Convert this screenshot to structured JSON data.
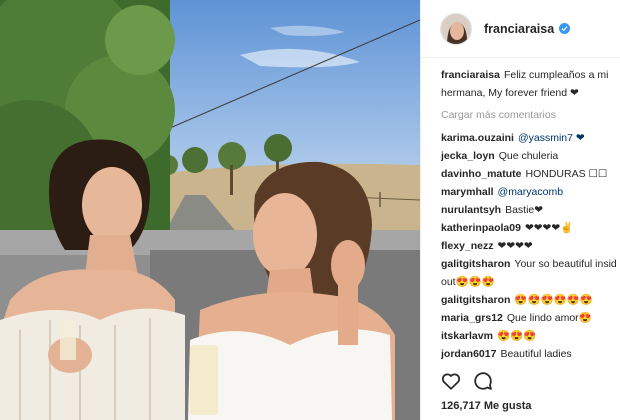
{
  "post": {
    "username": "franciaraisa",
    "caption": "Feliz cumpleaños a mi hermana, My forever friend ❤",
    "load_more": "Cargar más comentarios",
    "likes": "126,717 Me gusta"
  },
  "comments": [
    {
      "user": "karima.ouzaini",
      "text": "@yassmin7 ❤"
    },
    {
      "user": "jecka_loyn",
      "text": "Que chuleria"
    },
    {
      "user": "davinho_matute",
      "text": "HONDURAS ☐☐"
    },
    {
      "user": "marymhall",
      "text": "@maryacomb"
    },
    {
      "user": "nurulantsyh",
      "text": "Bastie❤"
    },
    {
      "user": "katherinpaola09",
      "text": "❤❤❤❤✌"
    },
    {
      "user": "flexy_nezz",
      "text": "❤❤❤❤"
    },
    {
      "user": "galitgitsharon",
      "text": "Your so beautiful insid out😍😍😍"
    },
    {
      "user": "galitgitsharon",
      "text": "😍😍😍😍😍😍"
    },
    {
      "user": "maria_grs12",
      "text": "Que lindo amor😍"
    },
    {
      "user": "itskarlavm",
      "text": "😍😍😍"
    },
    {
      "user": "jordan6017",
      "text": "Beautiful ladies"
    }
  ],
  "icons": {
    "verified": "verified-badge-icon",
    "like": "heart-icon",
    "comment": "comment-bubble-icon"
  },
  "colors": {
    "verified": "#3897f0",
    "mention": "#003569",
    "muted": "#999999",
    "text": "#262626"
  }
}
